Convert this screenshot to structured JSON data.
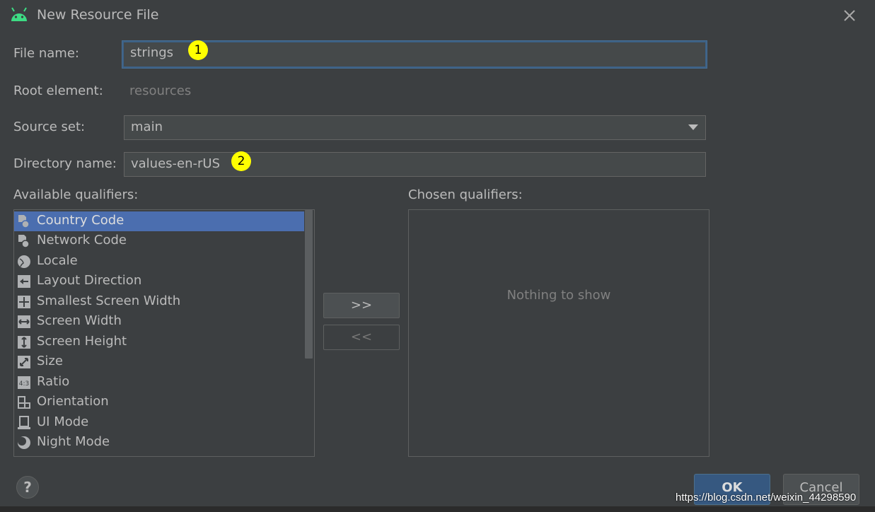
{
  "dialog": {
    "title": "New Resource File"
  },
  "form": {
    "file_name_label": "File name:",
    "file_name_value": "strings",
    "root_element_label": "Root element:",
    "root_element_value": "resources",
    "source_set_label": "Source set:",
    "source_set_value": "main",
    "directory_label": "Directory name:",
    "directory_value": "values-en-rUS"
  },
  "markers": {
    "one": "1",
    "two": "2"
  },
  "qualifiers": {
    "available_label": "Available qualifiers:",
    "chosen_label": "Chosen qualifiers:",
    "empty_text": "Nothing to show",
    "add_button": ">>",
    "remove_button": "<<",
    "items": [
      {
        "label": "Country Code",
        "icon": "country-code-icon",
        "selected": true
      },
      {
        "label": "Network Code",
        "icon": "network-code-icon"
      },
      {
        "label": "Locale",
        "icon": "globe-icon"
      },
      {
        "label": "Layout Direction",
        "icon": "layout-direction-icon"
      },
      {
        "label": "Smallest Screen Width",
        "icon": "smallest-screen-width-icon"
      },
      {
        "label": "Screen Width",
        "icon": "screen-width-icon"
      },
      {
        "label": "Screen Height",
        "icon": "screen-height-icon"
      },
      {
        "label": "Size",
        "icon": "size-icon"
      },
      {
        "label": "Ratio",
        "icon": "ratio-icon"
      },
      {
        "label": "Orientation",
        "icon": "orientation-icon"
      },
      {
        "label": "UI Mode",
        "icon": "ui-mode-icon"
      },
      {
        "label": "Night Mode",
        "icon": "night-mode-icon"
      }
    ]
  },
  "footer": {
    "help": "?",
    "ok": "OK",
    "cancel": "Cancel"
  },
  "watermark": "https://blog.csdn.net/weixin_44298590",
  "colors": {
    "accent": "#4b6eaf",
    "marker": "#ffff00",
    "ok_button": "#365880"
  }
}
